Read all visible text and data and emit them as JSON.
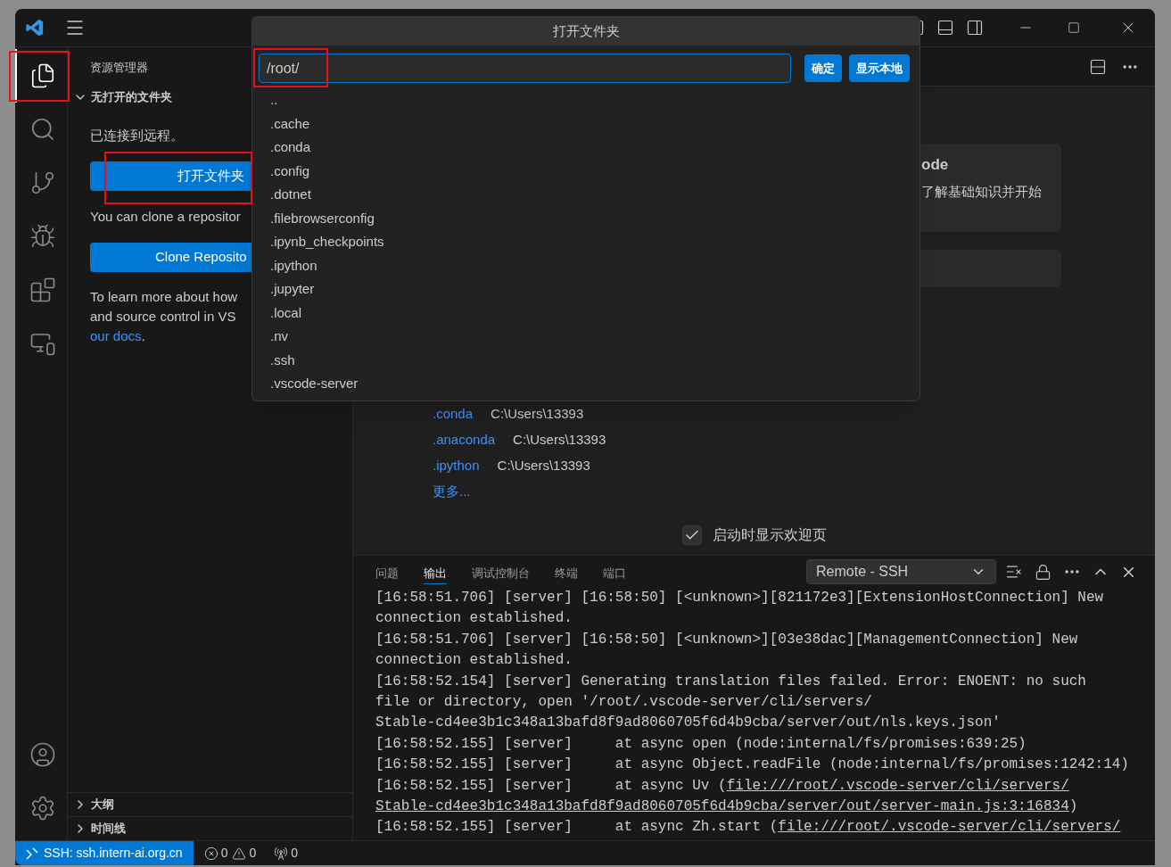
{
  "activity_bar": {
    "items": [
      {
        "kind": "explorer",
        "selected": true
      },
      {
        "kind": "search",
        "selected": false
      },
      {
        "kind": "source-control",
        "selected": false
      },
      {
        "kind": "debug",
        "selected": false
      },
      {
        "kind": "extensions",
        "selected": false
      },
      {
        "kind": "remote",
        "selected": false
      }
    ],
    "bottom_items": [
      {
        "kind": "account",
        "selected": false
      },
      {
        "kind": "settings",
        "selected": false
      }
    ]
  },
  "sidebar": {
    "title": "资源管理器",
    "section": {
      "title": "无打开的文件夹",
      "expanded": true
    },
    "remote_message": "已连接到远程。",
    "open_folder_button": "打开文件夹",
    "clone_hint": "You can clone a repositor",
    "clone_button": "Clone Reposito",
    "learn_more_lines": [
      "To learn more about how",
      "and source control in VS"
    ],
    "docs_link": "our docs",
    "docs_suffix": ".",
    "bottom_sections": [
      {
        "title": "大纲",
        "expanded": false
      },
      {
        "title": "时间线",
        "expanded": false
      }
    ]
  },
  "welcome": {
    "card": {
      "title": "ode",
      "description": "了解基础知识并开始"
    },
    "recent": [
      {
        "name": ".conda",
        "path": "C:\\Users\\13393"
      },
      {
        "name": ".anaconda",
        "path": "C:\\Users\\13393"
      },
      {
        "name": ".ipython",
        "path": "C:\\Users\\13393"
      }
    ],
    "more_link": "更多...",
    "show_on_startup": {
      "label": "启动时显示欢迎页",
      "checked": true
    }
  },
  "panel": {
    "tabs": [
      {
        "label": "问题",
        "selected": false
      },
      {
        "label": "输出",
        "selected": true
      },
      {
        "label": "调试控制台",
        "selected": false
      },
      {
        "label": "终端",
        "selected": false
      },
      {
        "label": "端口",
        "selected": false
      }
    ],
    "channel": "Remote - SSH",
    "log_lines": [
      [
        {
          "text": "[16:58:51.706] [server] [16:58:50] [<unknown>][821172e3][ExtensionHostConnection] New",
          "link": false
        }
      ],
      [
        {
          "text": "connection established.",
          "link": false
        }
      ],
      [
        {
          "text": "[16:58:51.706] [server] [16:58:50] [<unknown>][03e38dac][ManagementConnection] New",
          "link": false
        }
      ],
      [
        {
          "text": "connection established.",
          "link": false
        }
      ],
      [
        {
          "text": "[16:58:52.154] [server] Generating translation files failed. Error: ENOENT: no such",
          "link": false
        }
      ],
      [
        {
          "text": "file or directory, open '/root/.vscode-server/cli/servers/",
          "link": false
        }
      ],
      [
        {
          "text": "Stable-cd4ee3b1c348a13bafd8f9ad8060705f6d4b9cba/server/out/nls.keys.json'",
          "link": false
        }
      ],
      [
        {
          "text": "[16:58:52.155] [server]     at async open (node:internal/fs/promises:639:25)",
          "link": false
        }
      ],
      [
        {
          "text": "[16:58:52.155] [server]     at async Object.readFile (node:internal/fs/promises:1242:14)",
          "link": false
        }
      ],
      [
        {
          "text": "[16:58:52.155] [server]     at async Uv (",
          "link": false
        },
        {
          "text": "file:///root/.vscode-server/cli/servers/",
          "link": true
        }
      ],
      [
        {
          "text": "Stable-cd4ee3b1c348a13bafd8f9ad8060705f6d4b9cba/server/out/server-main.js:3:16834",
          "link": true
        },
        {
          "text": ")",
          "link": false
        }
      ],
      [
        {
          "text": "[16:58:52.155] [server]     at async Zh.start (",
          "link": false
        },
        {
          "text": "file:///root/.vscode-server/cli/servers/",
          "link": true
        }
      ]
    ]
  },
  "dialog": {
    "title": "打开文件夹",
    "path": "/root/",
    "buttons": [
      "确定",
      "显示本地"
    ],
    "entries": [
      "..",
      ".cache",
      ".conda",
      ".config",
      ".dotnet",
      ".filebrowserconfig",
      ".ipynb_checkpoints",
      ".ipython",
      ".jupyter",
      ".local",
      ".nv",
      ".ssh",
      ".vscode-server"
    ]
  },
  "status_bar": {
    "remote": "SSH: ssh.intern-ai.org.cn",
    "errors": "0",
    "warnings": "0",
    "ports": "0"
  }
}
